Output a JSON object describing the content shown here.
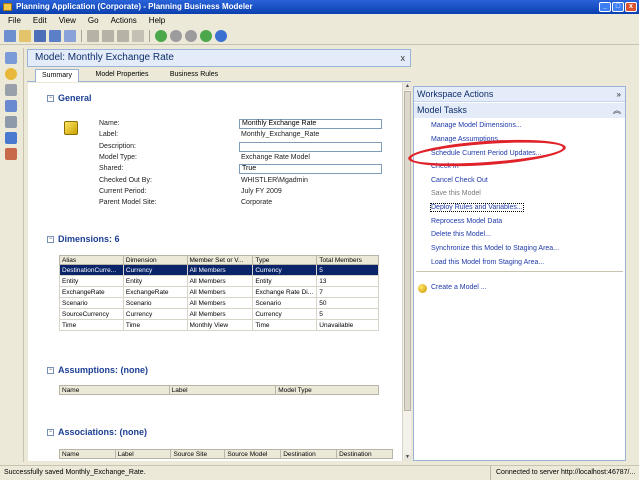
{
  "window": {
    "title": "Planning Application (Corporate) - Planning Business Modeler"
  },
  "menubar": [
    "File",
    "Edit",
    "View",
    "Go",
    "Actions",
    "Help"
  ],
  "document": {
    "header": "Model: Monthly Exchange Rate",
    "close": "x"
  },
  "tabs": [
    "Summary",
    "Model Properties",
    "Business Rules"
  ],
  "general": {
    "title": "General",
    "properties": [
      {
        "label": "Name:",
        "value": "Monthly Exchange Rate",
        "boxed": true
      },
      {
        "label": "Label:",
        "value": "Monthly_Exchange_Rate",
        "boxed": false
      },
      {
        "label": "Description:",
        "value": "",
        "boxed": true
      },
      {
        "label": "Model Type:",
        "value": "Exchange Rate Model",
        "boxed": false
      },
      {
        "label": "Shared:",
        "value": "True",
        "boxed": true
      },
      {
        "label": "Checked Out By:",
        "value": "WHISTLER\\Mgadmin",
        "boxed": false
      },
      {
        "label": "Current Period:",
        "value": "July FY 2009",
        "boxed": false
      },
      {
        "label": "Parent Model Site:",
        "value": "Corporate",
        "boxed": false
      }
    ]
  },
  "dimensions": {
    "title": "Dimensions: 6",
    "columns": [
      "Alias",
      "Dimension",
      "Member Set or V...",
      "Type",
      "Total Members"
    ],
    "rows": [
      [
        "DestinationCurre...",
        "Currency",
        "All Members",
        "Currency",
        "5"
      ],
      [
        "Entity",
        "Entity",
        "All Members",
        "Entity",
        "13"
      ],
      [
        "ExchangeRate",
        "ExchangeRate",
        "All Members",
        "Exchange Rate Di...",
        "7"
      ],
      [
        "Scenario",
        "Scenario",
        "All Members",
        "Scenario",
        "50"
      ],
      [
        "SourceCurrency",
        "Currency",
        "All Members",
        "Currency",
        "5"
      ],
      [
        "Time",
        "Time",
        "Monthly View",
        "Time",
        "Unavailable"
      ]
    ]
  },
  "assumptions": {
    "title": "Assumptions: (none)",
    "columns": [
      "Name",
      "Label",
      "Model Type"
    ]
  },
  "associations": {
    "title": "Associations: (none)",
    "columns": [
      "Name",
      "Label",
      "Source Site",
      "Source Model",
      "Destination",
      "Destination"
    ]
  },
  "workspace": {
    "title": "Workspace Actions",
    "model_tasks_title": "Model Tasks",
    "tasks": [
      {
        "label": "Manage Model Dimensions...",
        "state": "enabled"
      },
      {
        "label": "Manage Assumptions...",
        "state": "enabled"
      },
      {
        "label": "Schedule Current Period Updates...",
        "state": "enabled"
      },
      {
        "label": "Check In",
        "state": "enabled"
      },
      {
        "label": "Cancel Check Out",
        "state": "enabled"
      },
      {
        "label": "Save this Model",
        "state": "disabled"
      },
      {
        "label": "Deploy Rules and Variables...",
        "state": "focused"
      },
      {
        "label": "Reprocess Model Data",
        "state": "enabled"
      },
      {
        "label": "Delete this Model...",
        "state": "enabled"
      },
      {
        "label": "Synchronize this Model to Staging Area...",
        "state": "enabled"
      },
      {
        "label": "Load this Model from Staging Area...",
        "state": "enabled"
      }
    ],
    "create_model": "Create a Model ..."
  },
  "status": {
    "left": "Successfully saved Monthly_Exchange_Rate.",
    "right": "Connected to server http://localhost:46787/..."
  },
  "colors": {
    "accent": "#1f3aa8",
    "highlight": "#e0232a",
    "selection": "#0a246a"
  }
}
